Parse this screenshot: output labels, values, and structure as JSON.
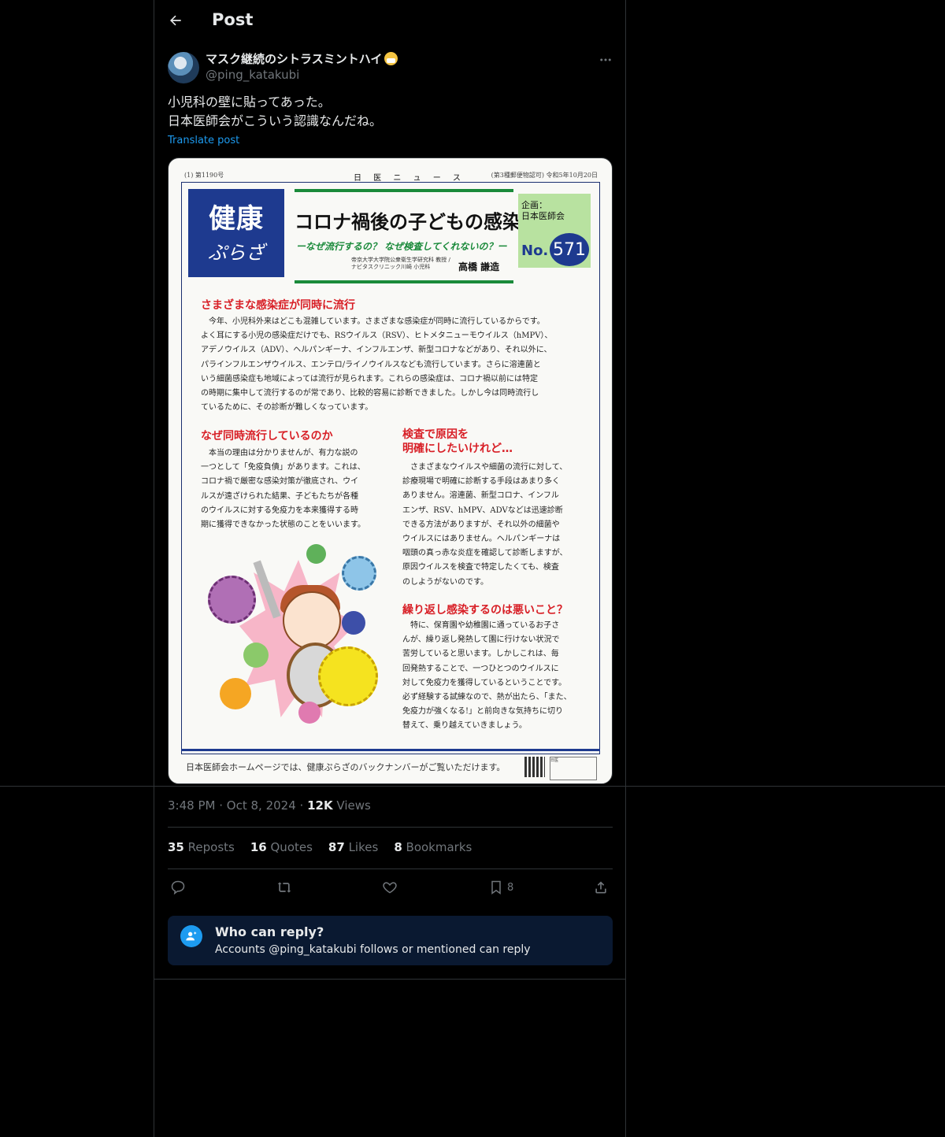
{
  "header": {
    "title": "Post"
  },
  "author": {
    "display_name": "マスク継続のシトラスミントハイ",
    "handle": "@ping_katakubi"
  },
  "tweet": {
    "lines": [
      "小児科の壁に貼ってあった。",
      "日本医師会がこういう認識なんだね。"
    ],
    "translate_label": "Translate post"
  },
  "newspaper": {
    "header_left": "(1)  第1190号",
    "header_center": "日 医 ニ ュ ー ス",
    "header_right": "(第3種郵便物認可)  令和5年10月20日",
    "logo_top": "健康",
    "logo_bottom": "ぷらざ",
    "headline": "コロナ禍後の子どもの感染症",
    "subhead": "ーなぜ流行するの？ なぜ検査してくれないの？ー",
    "author_affiliation": "帝京大学大学院公衆衛生学研究科 教授 / ナビタスクリニック川崎 小児科",
    "author_name": "高橋 謙造",
    "plan_label": "企画：",
    "plan_org": "日本医師会",
    "issue_prefix": "No.",
    "issue_number": "571",
    "sections": [
      {
        "title": "さまざまな感染症が同時に流行",
        "body": "　今年、小児科外来はどこも混雑しています。さまざまな感染症が同時に流行しているからです。\nよく耳にする小児の感染症だけでも、RSウイルス（RSV）、ヒトメタニューモウイルス（hMPV）、\nアデノウイルス（ADV）、ヘルパンギーナ、インフルエンザ、新型コロナなどがあり、それ以外に、\nパラインフルエンザウイルス、エンテロ/ライノウイルスなども流行しています。さらに溶連菌と\nいう細菌感染症も地域によっては流行が見られます。これらの感染症は、コロナ禍以前には特定\nの時期に集中して流行するのが常であり、比較的容易に診断できました。しかし今は同時流行し\nているために、その診断が難しくなっています。"
      },
      {
        "title": "なぜ同時流行しているのか",
        "body": "　本当の理由は分かりませんが、有力な説の\n一つとして「免疫負債」があります。これは、\nコロナ禍で厳密な感染対策が徹底され、ウイ\nルスが遠ざけられた結果、子どもたちが各種\nのウイルスに対する免疫力を本来獲得する時\n期に獲得できなかった状態のことをいいます。"
      },
      {
        "title": "検査で原因を\n明確にしたいけれど…",
        "body": "　さまざまなウイルスや細菌の流行に対して、\n診療現場で明確に診断する手段はあまり多く\nありません。溶連菌、新型コロナ、インフル\nエンザ、RSV、hMPV、ADVなどは迅速診断\nできる方法がありますが、それ以外の細菌や\nウイルスにはありません。ヘルパンギーナは\n咽頭の真っ赤な炎症を確認して診断しますが、\n原因ウイルスを検査で特定したくても、検査\nのしようがないのです。"
      },
      {
        "title": "繰り返し感染するのは悪いこと？",
        "body": "　特に、保育園や幼稚園に通っているお子さ\nんが、繰り返し発熱して園に行けない状況で\n苦労していると思います。しかしこれは、毎\n回発熱することで、一つひとつのウイルスに\n対して免疫力を獲得しているということです。\n必ず経験する試練なので、熱が出たら、「また、\n免疫力が強くなる!」と前向きな気持ちに切り\n替えて、乗り越えていきましょう。"
      }
    ],
    "footer": "日本医師会ホームページでは、健康ぷらざのバックナンバーがご覧いただけます。",
    "search_box_text": "日医"
  },
  "meta": {
    "time": "3:48 PM",
    "date": "Oct 8, 2024",
    "views_count": "12K",
    "views_label": "Views"
  },
  "stats": {
    "reposts": "35",
    "reposts_label": "Reposts",
    "quotes": "16",
    "quotes_label": "Quotes",
    "likes": "87",
    "likes_label": "Likes",
    "bookmarks": "8",
    "bookmarks_label": "Bookmarks"
  },
  "actions": {
    "bookmark_count": "8"
  },
  "reply_restriction": {
    "title": "Who can reply?",
    "subtitle": "Accounts @ping_katakubi follows or mentioned can reply"
  },
  "colors": {
    "background": "#000000",
    "text": "#e7e9ea",
    "muted": "#71767b",
    "accent": "#1d9bf0",
    "divider": "#2f3336",
    "reply_box": "#0a1931"
  }
}
